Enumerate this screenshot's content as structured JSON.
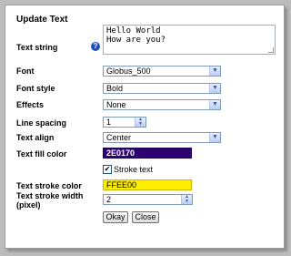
{
  "dialog": {
    "title": "Update Text",
    "text_string": {
      "label": "Text string",
      "line1": "Hello World",
      "line2": "How are you?"
    },
    "font": {
      "label": "Font",
      "value": "Globus_500"
    },
    "font_style": {
      "label": "Font style",
      "value": "Bold"
    },
    "effects": {
      "label": "Effects",
      "value": "None"
    },
    "line_spacing": {
      "label": "Line spacing",
      "value": "1"
    },
    "text_align": {
      "label": "Text align",
      "value": "Center"
    },
    "fill_color": {
      "label": "Text fill color",
      "value": "2E0170",
      "color": "#2E0170"
    },
    "stroke_text": {
      "label": "Stroke text",
      "checked": true,
      "mark": "✔"
    },
    "stroke_color": {
      "label": "Text stroke color",
      "value": "FFEE00",
      "color": "#FFEE00"
    },
    "stroke_width": {
      "label_line1": "Text stroke width",
      "label_line2": "(pixel)",
      "value": "2"
    },
    "buttons": {
      "okay": "Okay",
      "close": "Close"
    }
  }
}
